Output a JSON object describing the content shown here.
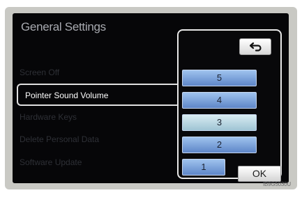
{
  "screen": {
    "title": "General Settings",
    "items": [
      {
        "label": "Screen Off"
      },
      {
        "label": "Pointer Sound Volume"
      },
      {
        "label": "Hardware Keys"
      },
      {
        "label": "Delete Personal Data"
      },
      {
        "label": "Software Update"
      }
    ]
  },
  "popup": {
    "back_icon": "back-arrow-icon",
    "options": [
      {
        "label": "5"
      },
      {
        "label": "4"
      },
      {
        "label": "3"
      },
      {
        "label": "2"
      },
      {
        "label": "1"
      }
    ],
    "selected_value": "3",
    "ok_label": "OK"
  },
  "image_code": "IB9G5030U",
  "colors": {
    "option_button": "#6f95d2",
    "selected_option": "#bcdde8",
    "screen_bg": "#060608"
  }
}
